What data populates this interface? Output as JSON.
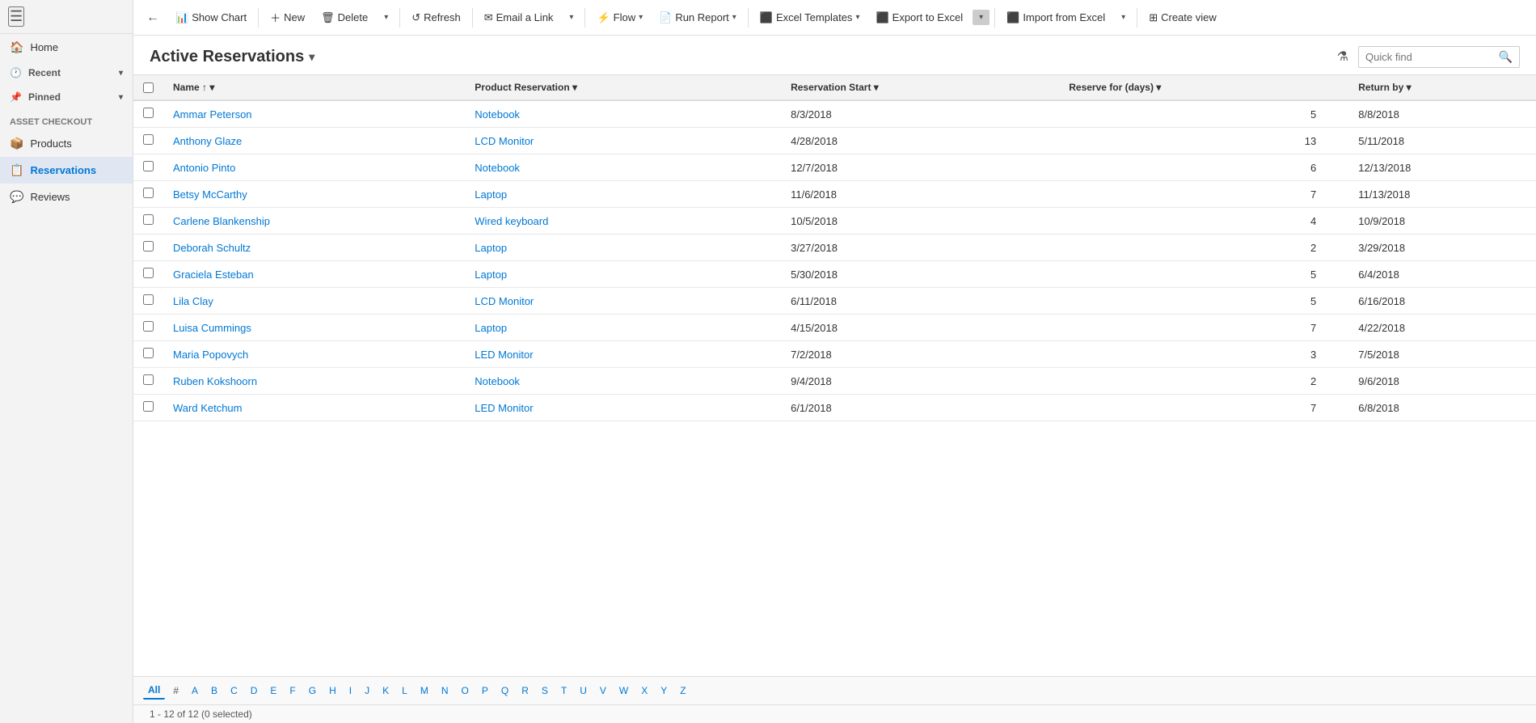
{
  "sidebar": {
    "menu_icon": "☰",
    "items": [
      {
        "id": "home",
        "label": "Home",
        "icon": "🏠",
        "active": false
      },
      {
        "id": "recent",
        "label": "Recent",
        "icon": "🕐",
        "active": false,
        "expandable": true
      },
      {
        "id": "pinned",
        "label": "Pinned",
        "icon": "📌",
        "active": false,
        "expandable": true
      }
    ],
    "group_label": "Asset Checkout",
    "sub_items": [
      {
        "id": "products",
        "label": "Products",
        "icon": "📦",
        "active": false
      },
      {
        "id": "reservations",
        "label": "Reservations",
        "icon": "📋",
        "active": true
      },
      {
        "id": "reviews",
        "label": "Reviews",
        "icon": "💬",
        "active": false
      }
    ]
  },
  "toolbar": {
    "back_label": "←",
    "show_chart_label": "Show Chart",
    "new_label": "New",
    "delete_label": "Delete",
    "refresh_label": "Refresh",
    "email_link_label": "Email a Link",
    "flow_label": "Flow",
    "run_report_label": "Run Report",
    "excel_templates_label": "Excel Templates",
    "export_to_excel_label": "Export to Excel",
    "import_from_excel_label": "Import from Excel",
    "create_view_label": "Create view"
  },
  "view": {
    "title": "Active Reservations",
    "filter_icon": "⚗",
    "quick_find_placeholder": "Quick find"
  },
  "table": {
    "columns": [
      {
        "id": "name",
        "label": "Name",
        "sort": "↑",
        "sortable": true
      },
      {
        "id": "product",
        "label": "Product Reservation",
        "sortable": true
      },
      {
        "id": "start",
        "label": "Reservation Start",
        "sortable": true
      },
      {
        "id": "reserve_days",
        "label": "Reserve for (days)",
        "sortable": true
      },
      {
        "id": "return_by",
        "label": "Return by",
        "sortable": true
      }
    ],
    "rows": [
      {
        "name": "Ammar Peterson",
        "product": "Notebook",
        "start": "8/3/2018",
        "reserve_days": "5",
        "return_by": "8/8/2018"
      },
      {
        "name": "Anthony Glaze",
        "product": "LCD Monitor",
        "start": "4/28/2018",
        "reserve_days": "13",
        "return_by": "5/11/2018"
      },
      {
        "name": "Antonio Pinto",
        "product": "Notebook",
        "start": "12/7/2018",
        "reserve_days": "6",
        "return_by": "12/13/2018"
      },
      {
        "name": "Betsy McCarthy",
        "product": "Laptop",
        "start": "11/6/2018",
        "reserve_days": "7",
        "return_by": "11/13/2018"
      },
      {
        "name": "Carlene Blankenship",
        "product": "Wired keyboard",
        "start": "10/5/2018",
        "reserve_days": "4",
        "return_by": "10/9/2018"
      },
      {
        "name": "Deborah Schultz",
        "product": "Laptop",
        "start": "3/27/2018",
        "reserve_days": "2",
        "return_by": "3/29/2018"
      },
      {
        "name": "Graciela Esteban",
        "product": "Laptop",
        "start": "5/30/2018",
        "reserve_days": "5",
        "return_by": "6/4/2018"
      },
      {
        "name": "Lila Clay",
        "product": "LCD Monitor",
        "start": "6/11/2018",
        "reserve_days": "5",
        "return_by": "6/16/2018"
      },
      {
        "name": "Luisa Cummings",
        "product": "Laptop",
        "start": "4/15/2018",
        "reserve_days": "7",
        "return_by": "4/22/2018"
      },
      {
        "name": "Maria Popovych",
        "product": "LED Monitor",
        "start": "7/2/2018",
        "reserve_days": "3",
        "return_by": "7/5/2018"
      },
      {
        "name": "Ruben Kokshoorn",
        "product": "Notebook",
        "start": "9/4/2018",
        "reserve_days": "2",
        "return_by": "9/6/2018"
      },
      {
        "name": "Ward Ketchum",
        "product": "LED Monitor",
        "start": "6/1/2018",
        "reserve_days": "7",
        "return_by": "6/8/2018"
      }
    ]
  },
  "pagination": {
    "letters": [
      "All",
      "#",
      "A",
      "B",
      "C",
      "D",
      "E",
      "F",
      "G",
      "H",
      "I",
      "J",
      "K",
      "L",
      "M",
      "N",
      "O",
      "P",
      "Q",
      "R",
      "S",
      "T",
      "U",
      "V",
      "W",
      "X",
      "Y",
      "Z"
    ],
    "active": "All"
  },
  "status": {
    "text": "1 - 12 of 12 (0 selected)"
  }
}
